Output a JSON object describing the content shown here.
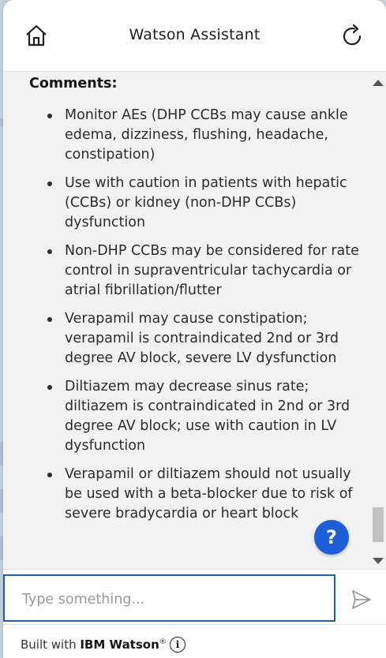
{
  "header": {
    "title": "Watson Assistant",
    "home_icon": "home-icon",
    "restart_icon": "restart-icon"
  },
  "content": {
    "comments_label": "Comments:",
    "items": [
      "Monitor AEs (DHP CCBs may cause ankle edema, dizziness, flushing, headache, constipation)",
      "Use with caution in patients with hepatic (CCBs) or kidney (non-DHP CCBs) dysfunction",
      "Non-DHP CCBs may be considered for rate control in supraventricular tachycardia or atrial fibrillation/flutter",
      "Verapamil may cause constipation; verapamil is contraindicated 2nd or 3rd degree AV block, severe LV dysfunction",
      "Diltiazem may decrease sinus rate; diltiazem is contraindicated in 2nd or 3rd degree AV block; use with caution in LV dysfunction",
      "Verapamil or diltiazem should not usually be used with a beta-blocker due to risk of severe bradycardia or heart block"
    ],
    "help_label": "?"
  },
  "input": {
    "placeholder": "Type something...",
    "value": ""
  },
  "footer": {
    "built_with": "Built with",
    "brand": "IBM Watson",
    "registered": "®",
    "info_label": "i"
  },
  "colors": {
    "accent": "#1e5eb5",
    "help_button": "#1d5ed8",
    "content_bg": "#f2f2f2"
  }
}
